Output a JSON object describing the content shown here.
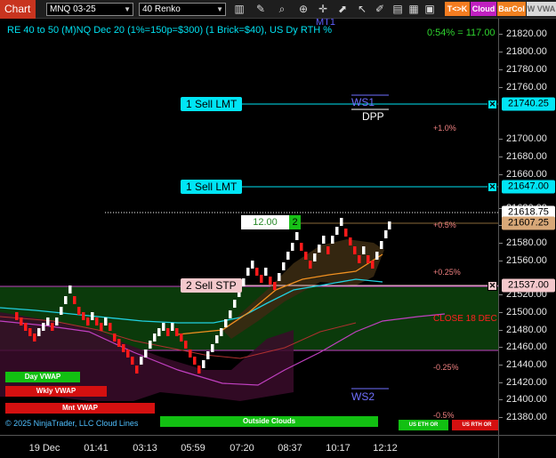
{
  "toolbar": {
    "chart_tab": "Chart",
    "instrument": "MNQ 03-25",
    "bar_type": "40 Renko",
    "icons": [
      "pencil-icon",
      "magnifier-icon",
      "zoom-in-icon",
      "crosshair-icon",
      "arrow-icon",
      "text-icon",
      "draw-icon",
      "save-icon",
      "grid-icon",
      "calendar-icon",
      "scroll-icon"
    ],
    "btn_tk": "T<>K",
    "btn_cloud": "Cloud",
    "btn_barcol": "BarCol",
    "btn_vwap": "W VWA"
  },
  "chart": {
    "header": "RE 40 to 50 (M)NQ Dec 20 (1%=150p=$300) (1 Brick=$40), US Dy RTH %",
    "header_right": "0:54% = 117.00",
    "orders": [
      {
        "label": "1 Sell LMT",
        "price": "21740.25"
      },
      {
        "label": "1 Sell LMT",
        "price": "21647.00"
      },
      {
        "label": "2 Sell STP",
        "price": "21537.00"
      }
    ],
    "last_price": "21618.75",
    "position_price": "21607.25",
    "qty_value": "12.00",
    "qty_count": "2",
    "levels": {
      "ws1": "WS1",
      "dpp": "DPP",
      "ws2": "WS2",
      "mt": "MT1",
      "close": "CLOSE 18 DEC"
    },
    "pct": [
      "+1.0%",
      "+0.5%",
      "+0.25%",
      "-0.25%",
      "-0.5%"
    ],
    "vwap_tags": [
      "Day VWAP",
      "Wkly VWAP",
      "Mnt VWAP"
    ],
    "cloud_tags": [
      "Outside Clouds",
      "US ETH OR",
      "US RTH OR"
    ],
    "copyright": "© 2025 NinjaTrader, LLC Cloud Lines"
  },
  "price_axis": [
    "21820.00",
    "21800.00",
    "21780.00",
    "21760.00",
    "21700.00",
    "21680.00",
    "21660.00",
    "21620.00",
    "21600.00",
    "21580.00",
    "21560.00",
    "21520.00",
    "21500.00",
    "21480.00",
    "21460.00",
    "21440.00",
    "21420.00",
    "21400.00",
    "21380.00"
  ],
  "time_axis": [
    "19 Dec",
    "01:41",
    "03:13",
    "05:59",
    "07:20",
    "08:37",
    "10:17",
    "12:12"
  ],
  "colors": {
    "accent": "#00e5f5",
    "sell_stop": "#f4c8cc",
    "up_brick": "#ffffff",
    "down_brick": "#ff1a1a",
    "cloud_green": "#0d3d0d",
    "cloud_brown": "#3a2a10"
  }
}
